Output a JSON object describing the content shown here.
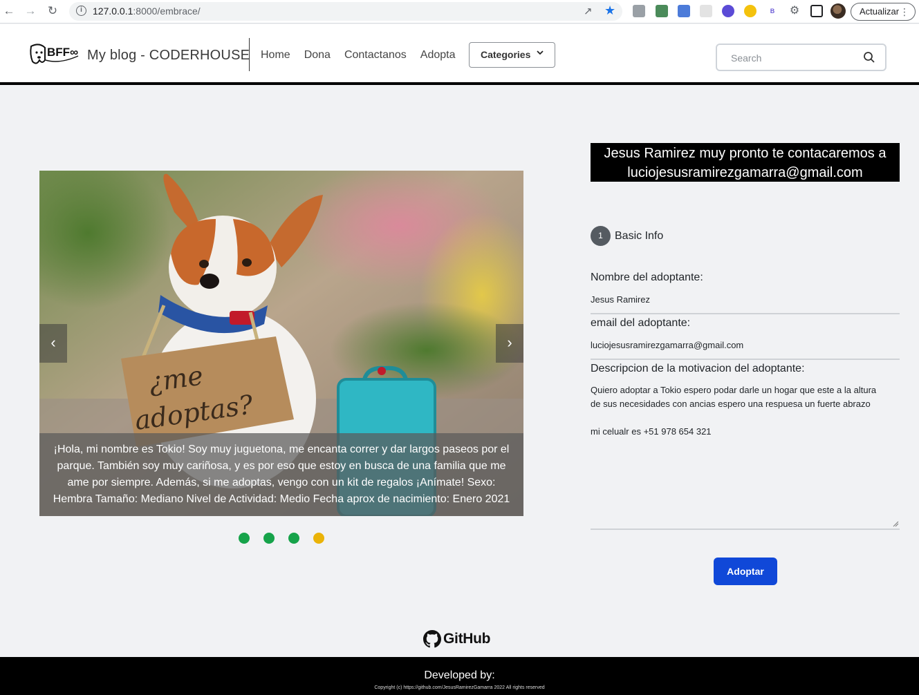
{
  "browser": {
    "url_host": "127.0.0.1",
    "url_path": ":8000/embrace/",
    "update_label": "Actualizar"
  },
  "navbar": {
    "brand": "My blog - CODERHOUSE",
    "logo_text": "BFF∞",
    "links": [
      "Home",
      "Dona",
      "Contactanos",
      "Adopta"
    ],
    "dropdown_label": "Categories",
    "search_placeholder": "Search"
  },
  "carousel": {
    "sign_text_1": "¿me",
    "sign_text_2": "adoptas?",
    "caption": "¡Hola, mi nombre es Tokio! Soy muy juguetona, me encanta correr y dar largos paseos por el parque. También soy muy cariñosa, y es por eso que estoy en busca de una familia que me ame por siempre. Además, si me adoptas, vengo con un kit de regalos ¡Anímate! Sexo: Hembra Tamaño: Mediano Nivel de Actividad: Medio Fecha aprox de nacimiento: Enero 2021",
    "prev_symbol": "‹",
    "next_symbol": "›",
    "indicator_colors": [
      "#16a34a",
      "#16a34a",
      "#16a34a",
      "#eab308"
    ]
  },
  "form": {
    "banner": "Jesus Ramirez muy pronto te contacaremos a luciojesusramirezgamarra@gmail.com",
    "step_number": "1",
    "step_label": "Basic Info",
    "name_label": "Nombre del adoptante:",
    "name_value": "Jesus Ramirez",
    "email_label": "email del adoptante:",
    "email_value": "luciojesusramirezgamarra@gmail.com",
    "motivation_label": "Descripcion de la motivacion del adoptante:",
    "motivation_lines": [
      "Quiero adoptar a Tokio espero podar darle un hogar que este a la altura",
      "de sus necesidades con ancias espero una respuesa un fuerte abrazo",
      "",
      "mi celualr es +51 978 654 321"
    ],
    "submit_label": "Adoptar"
  },
  "footer": {
    "github_label": "GitHub",
    "developed_by": "Developed by:",
    "copyright": "Copyright (c) https://github.com/JesusRamirezGamarra 2022 All rights reserved"
  },
  "colors": {
    "accent": "#1048d8",
    "page_bg": "#f1f2f4"
  }
}
